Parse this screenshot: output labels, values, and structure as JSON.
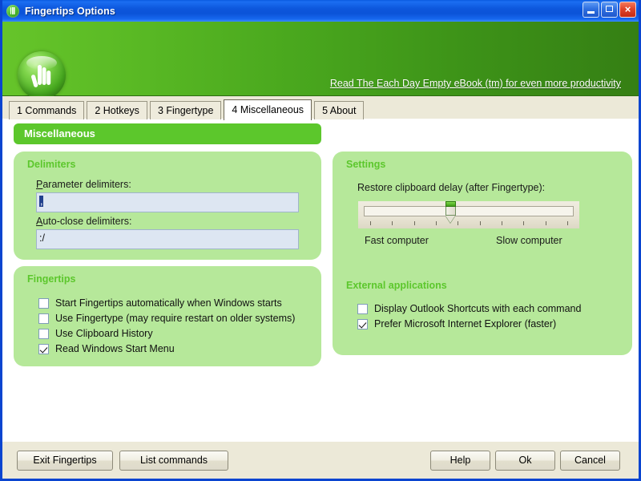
{
  "window": {
    "title": "Fingertips Options",
    "title_icon": "hand-icon",
    "controls": {
      "minimize": "minimize-button",
      "maximize": "maximize-button",
      "close": "close-button",
      "close_glyph": "×"
    }
  },
  "banner": {
    "logo_icon": "fingertips-hand-logo",
    "link_text": "Read The Each Day Empty eBook (tm) for even more productivity"
  },
  "tabs": [
    {
      "label": "1 Commands",
      "active": false
    },
    {
      "label": "2 Hotkeys",
      "active": false
    },
    {
      "label": "3 Fingertype",
      "active": false
    },
    {
      "label": "4 Miscellaneous",
      "active": true
    },
    {
      "label": "5 About",
      "active": false
    }
  ],
  "section": {
    "header": "Miscellaneous"
  },
  "delimiters": {
    "title": "Delimiters",
    "parameter_label": "Parameter delimiters:",
    "parameter_label_accel": "P",
    "parameter_value": ",",
    "parameter_value_selected": true,
    "autoclose_label": "Auto-close delimiters:",
    "autoclose_label_accel": "A",
    "autoclose_value": ":/"
  },
  "fingertips": {
    "title": "Fingertips",
    "checkboxes": [
      {
        "label": "Start Fingertips automatically when Windows starts",
        "checked": false
      },
      {
        "label": "Use Fingertype (may require restart on older systems)",
        "checked": false
      },
      {
        "label": "Use Clipboard History",
        "checked": false
      },
      {
        "label": "Read Windows Start Menu",
        "checked": true
      }
    ]
  },
  "settings": {
    "title": "Settings",
    "slider_label": "Restore clipboard delay (after Fingertype):",
    "slider_min_label": "Fast computer",
    "slider_max_label": "Slow computer",
    "slider_ticks": 10,
    "slider_position_percent": 41
  },
  "external": {
    "title": "External applications",
    "checkboxes": [
      {
        "label": "Display Outlook Shortcuts with each command",
        "checked": false
      },
      {
        "label": "Prefer Microsoft Internet Explorer (faster)",
        "checked": true
      }
    ]
  },
  "footer": {
    "exit": "Exit Fingertips",
    "list": "List commands",
    "help": "Help",
    "ok": "Ok",
    "cancel": "Cancel"
  },
  "colors": {
    "titlebar_blue": "#0d57dc",
    "banner_green_light": "#66c42a",
    "banner_green_dark": "#357f14",
    "accent_green": "#5cc72c",
    "panel_green": "#b6e89a",
    "dialog_face": "#ece9d8",
    "field_blue": "#dde6f2",
    "selection_blue": "#22418e"
  }
}
